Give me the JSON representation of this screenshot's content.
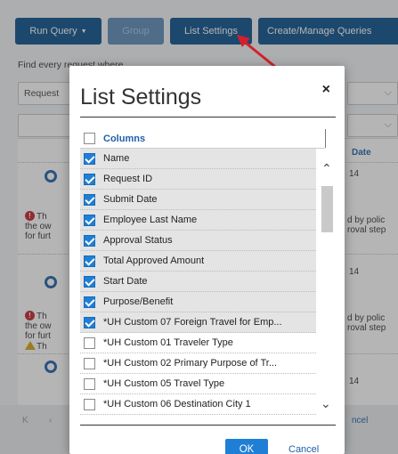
{
  "toolbar": {
    "run_query": "Run Query",
    "group": "Group",
    "list_settings": "List Settings",
    "create_manage": "Create/Manage Queries"
  },
  "find_label": "Find every request where",
  "background": {
    "select_text": "Request",
    "col_date": "Date",
    "num1": "14",
    "num2": "14",
    "num3": "14",
    "warn_left_1": "Th",
    "warn_left_2": "the ow",
    "warn_left_3": "for furt",
    "warn_right_1": "d by polic",
    "warn_right_2": "roval step",
    "footer_cancel": "ncel",
    "footer_k": "K"
  },
  "modal": {
    "title": "List Settings",
    "close": "×",
    "columns_header": "Columns",
    "ok": "OK",
    "cancel": "Cancel",
    "items": [
      {
        "label": "Name",
        "checked": true
      },
      {
        "label": "Request ID",
        "checked": true
      },
      {
        "label": "Submit Date",
        "checked": true
      },
      {
        "label": "Employee Last Name",
        "checked": true
      },
      {
        "label": "Approval Status",
        "checked": true
      },
      {
        "label": "Total Approved Amount",
        "checked": true
      },
      {
        "label": "Start Date",
        "checked": true
      },
      {
        "label": "Purpose/Benefit",
        "checked": true
      },
      {
        "label": "*UH Custom 07 Foreign Travel for Emp...",
        "checked": true
      },
      {
        "label": "*UH Custom 01 Traveler Type",
        "checked": false
      },
      {
        "label": "*UH Custom 02 Primary Purpose of Tr...",
        "checked": false
      },
      {
        "label": "*UH Custom 05 Travel Type",
        "checked": false
      },
      {
        "label": "*UH Custom 06 Destination City 1",
        "checked": false
      }
    ]
  },
  "colors": {
    "toolbar_blue": "#0b4f8c",
    "accent_blue": "#1f7fd6",
    "arrow_red": "#d3212c"
  }
}
